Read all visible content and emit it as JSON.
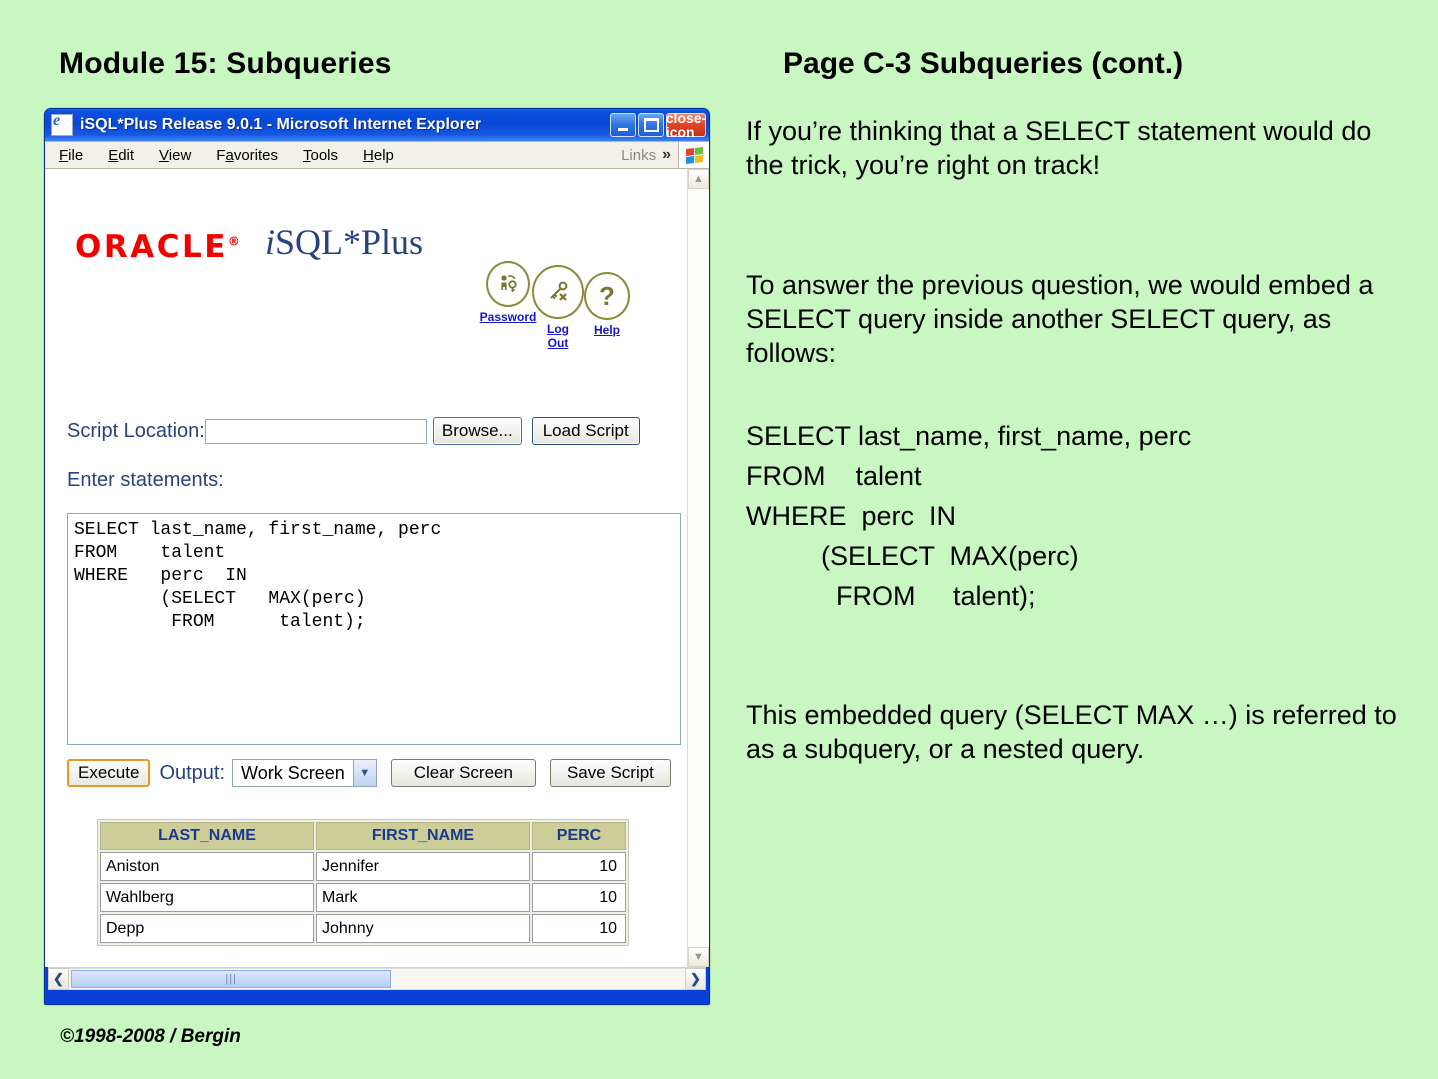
{
  "slide": {
    "title_left": "Module 15: Subqueries",
    "title_right": "Page C-3  Subqueries (cont.)",
    "footer": "©1998-2008 / Bergin",
    "background_color": "#c9f7c2",
    "paragraph_1": "If you’re thinking that a SELECT statement would do the trick, you’re right on track!",
    "paragraph_2": "To answer the previous question, we would embed a SELECT query inside another SELECT query, as follows:",
    "code_block": "SELECT last_name, first_name, perc\nFROM    talent\nWHERE  perc  IN\n          (SELECT  MAX(perc)\n            FROM     talent);",
    "paragraph_3": "This embedded query (SELECT MAX …) is referred to as a subquery, or a nested query."
  },
  "browser": {
    "window_title": "iSQL*Plus Release 9.0.1 - Microsoft Internet Explorer",
    "title_bar_color": "#0b47d8",
    "doc_icon": "ie-document-icon",
    "window_buttons": [
      {
        "name": "minimize-button",
        "glyph": "minimize-icon",
        "label": "Minimize"
      },
      {
        "name": "maximize-button",
        "glyph": "maximize-icon",
        "label": "Maximize"
      },
      {
        "name": "close-button",
        "glyph": "close-icon",
        "label": "✕"
      }
    ],
    "menu": [
      {
        "pre": "",
        "acc": "F",
        "post": "ile"
      },
      {
        "pre": "",
        "acc": "E",
        "post": "dit"
      },
      {
        "pre": "",
        "acc": "V",
        "post": "iew"
      },
      {
        "pre": "F",
        "acc": "a",
        "post": "vorites"
      },
      {
        "pre": "",
        "acc": "T",
        "post": "ools"
      },
      {
        "pre": "",
        "acc": "H",
        "post": "elp"
      }
    ],
    "links_label": "Links",
    "links_chevrons": "»",
    "windows_flag": "windows-logo-icon"
  },
  "page": {
    "oracle_logo": "ORACLE",
    "oracle_logo_mark": "®",
    "oracle_logo_color": "#f20000",
    "wordmark_italic": "i",
    "wordmark_rest": "SQL*Plus",
    "wordmark_color": "#27427f",
    "header_icons": [
      {
        "icon": "password-key-icon",
        "glyph": "⚿",
        "label": "Password"
      },
      {
        "icon": "logout-key-icon",
        "glyph": "⚷",
        "label": "Log\nOut"
      },
      {
        "icon": "help-question-icon",
        "glyph": "?",
        "label": "Help"
      }
    ],
    "script_location_label": "Script Location:",
    "script_location_value": "",
    "script_location_placeholder": "",
    "browse_button": "Browse...",
    "load_script_button": "Load Script",
    "enter_statements_label": "Enter statements:",
    "sql_text": "SELECT last_name, first_name, perc\nFROM    talent\nWHERE   perc  IN\n        (SELECT   MAX(perc)\n         FROM      talent);",
    "execute_button": "Execute",
    "output_label": "Output:",
    "output_selected": "Work Screen",
    "output_options": [
      "Work Screen"
    ],
    "clear_screen_button": "Clear Screen",
    "save_script_button": "Save Script",
    "results": {
      "headers": [
        "LAST_NAME",
        "FIRST_NAME",
        "PERC"
      ],
      "header_bg": "#cdcd99",
      "header_color": "#1a3a8f",
      "rows": [
        [
          "Aniston",
          "Jennifer",
          "10"
        ],
        [
          "Wahlberg",
          "Mark",
          "10"
        ],
        [
          "Depp",
          "Johnny",
          "10"
        ]
      ]
    },
    "scroll": {
      "up_arrow": "▲",
      "down_arrow": "▼",
      "left_arrow": "❮",
      "right_arrow": "❯",
      "thumb_grip": "|||"
    }
  }
}
